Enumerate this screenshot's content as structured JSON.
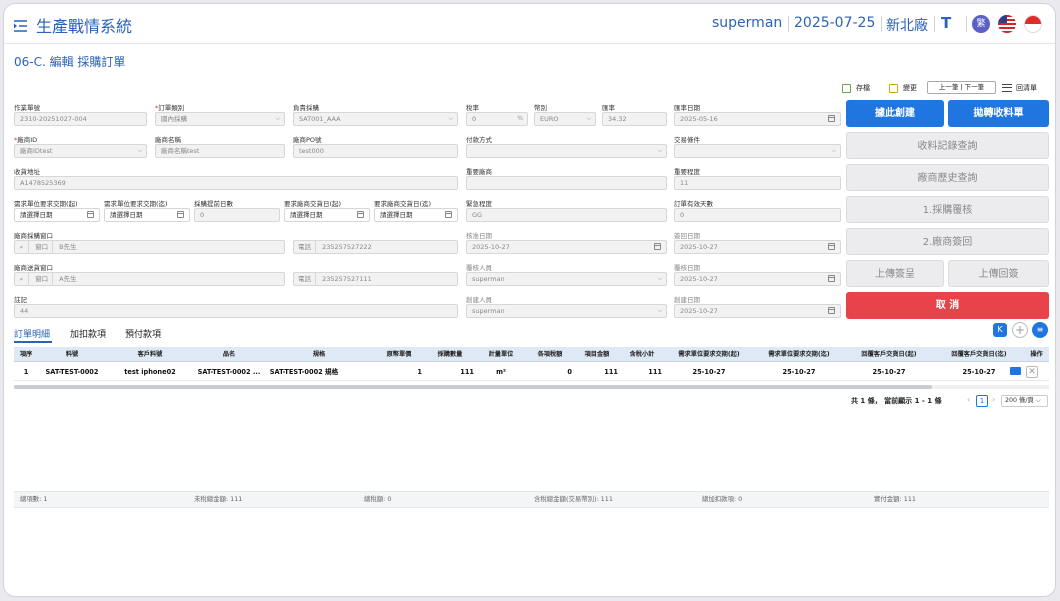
{
  "header": {
    "app_title": "生產戰情系統",
    "user": "superman",
    "date": "2025-07-25",
    "factory": "新北廠",
    "font_toggle": "T",
    "lang_badge": "繁"
  },
  "page_title": "06-C. 編輯 採購訂單",
  "toolbar": {
    "save": "存檔",
    "change": "變更",
    "prev_next": "上一筆 | 下一筆",
    "back_to_list": "回清單"
  },
  "form": {
    "doc_no_label": "作業單號",
    "doc_no": "2310-20251027-004",
    "order_type_label": "訂單類別",
    "order_type": "國內採購",
    "buyer_label": "負責採購",
    "buyer": "SAT001_AAA",
    "tax_rate_label": "稅率",
    "tax_rate": "0",
    "tax_rate_unit": "%",
    "currency_label": "幣別",
    "currency": "EURO",
    "exchange_rate_label": "匯率",
    "exchange_rate": "34.32",
    "exchange_date_label": "匯率日期",
    "exchange_date": "2025-05-16",
    "vendor_id_label": "廠商ID",
    "vendor_id": "廠商IDtest",
    "vendor_name_label": "廠商名稱",
    "vendor_name": "廠商名稱test",
    "vendor_po_label": "廠商PO號",
    "vendor_po": "test000",
    "payment_label": "付款方式",
    "payment": "",
    "trade_terms_label": "交易條件",
    "trade_terms": "",
    "ship_addr_label": "收貨地址",
    "ship_addr": "A1478525369",
    "important_vendor_label": "重要廠商",
    "important_vendor": "",
    "importance_label": "重要程度",
    "importance": "11",
    "req_start_label": "需求單位要求交期(起)",
    "req_start": "請選擇日期",
    "req_end_label": "需求單位要求交期(迄)",
    "req_end": "請選擇日期",
    "lead_days_label": "採購提前日數",
    "lead_days": "0",
    "vendor_start_label": "要求廠商交貨日(起)",
    "vendor_start": "請選擇日期",
    "vendor_end_label": "要求廠商交貨日(迄)",
    "vendor_end": "請選擇日期",
    "urgency_label": "緊急程度",
    "urgency": "GG",
    "valid_days_label": "訂單有效天數",
    "valid_days": "0",
    "purchase_contact_label": "廠商採購窗口",
    "window_tag": "窗口",
    "purchase_contact": "B先生",
    "phone_tag": "電話",
    "purchase_phone": "235257527222",
    "approve_date_label": "核准日期",
    "approve_date": "2025-10-27",
    "sign_back_label": "簽回日期",
    "sign_back": "2025-10-27",
    "delivery_contact_label": "廠商送貨窗口",
    "delivery_contact": "A先生",
    "delivery_phone": "235257527111",
    "reviewer_label": "覆核人員",
    "reviewer": "superman",
    "review_date_label": "覆核日期",
    "review_date": "2025-10-27",
    "note_label": "註記",
    "note": "44",
    "creator_label": "創建人員",
    "creator": "superman",
    "create_date_label": "創建日期",
    "create_date": "2025-10-27"
  },
  "actions": {
    "create_from": "據此創建",
    "to_receipt": "拋轉收料單",
    "receipt_query": "收料記錄查詢",
    "vendor_history": "廠商歷史查詢",
    "review1": "1.採購覆核",
    "sign_back2": "2.廠商簽回",
    "upload_submit": "上傳簽呈",
    "upload_return": "上傳回簽",
    "cancel": "取 消"
  },
  "tabs": [
    "訂單明細",
    "加扣款項",
    "預付款項"
  ],
  "table": {
    "headers": [
      "項序",
      "料號",
      "客戶料號",
      "品名",
      "規格",
      "原幣單價",
      "採購數量",
      "計量單位",
      "各項稅額",
      "項目金額",
      "含稅小計",
      "需求單位要求交期(起)",
      "需求單位要求交期(迄)",
      "回覆客戶交貨日(起)",
      "回覆客戶交貨日(迄)",
      "操作"
    ],
    "rows": [
      [
        "1",
        "SAT-TEST-0002",
        "test iphone02",
        "SAT-TEST-0002 ...",
        "SAT-TEST-0002 規格",
        "1",
        "111",
        "m²",
        "0",
        "111",
        "111",
        "25-10-27",
        "25-10-27",
        "25-10-27",
        "25-10-27"
      ]
    ]
  },
  "pagination": {
    "summary": "共 1 條， 當前顯示 1 - 1 條",
    "page": "1",
    "page_size": "200 條/頁"
  },
  "summary": {
    "items": "總項數: 1",
    "untaxed": "未稅總金額: 111",
    "tax": "總稅額: 0",
    "taxed": "含稅總金額(交易幣別): 111",
    "deductions": "總加扣款項: 0",
    "paid": "實付金額: 111"
  },
  "colors": {
    "primary": "#1f76e0",
    "danger": "#e8434a",
    "title_blue": "#2a63b8"
  }
}
